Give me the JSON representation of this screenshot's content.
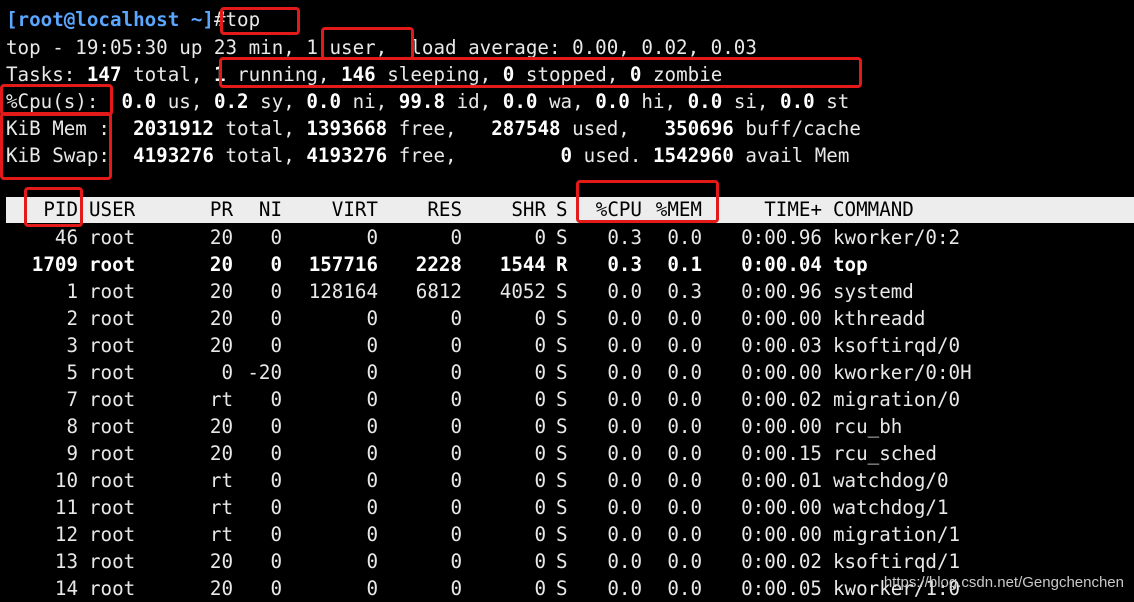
{
  "prompt": {
    "user_host": "[root@localhost ~]",
    "command": "#top"
  },
  "summary": {
    "line1": {
      "prefix": "top - 19:05:30 up 23 min, ",
      "users": "1 user,",
      "load": "  load average: 0.00, 0.02, 0.03"
    },
    "line2": {
      "label": "Tasks: ",
      "total": "147",
      "total_word": " total, ",
      "running": "1",
      "running_word": " running, ",
      "sleeping": "146",
      "sleeping_word": " sleeping, ",
      "stopped": "0",
      "stopped_word": " stopped, ",
      "zombie": "0",
      "zombie_word": " zombie"
    },
    "line3": {
      "label": "%Cpu(s):",
      "us": "0.0",
      "us_word": " us, ",
      "sy": "0.2",
      "sy_word": " sy, ",
      "ni": "0.0",
      "ni_word": " ni, ",
      "id": "99.8",
      "id_word": " id, ",
      "wa": "0.0",
      "wa_word": " wa, ",
      "hi": "0.0",
      "hi_word": " hi, ",
      "si": "0.0",
      "si_word": " si, ",
      "st": "0.0",
      "st_word": " st"
    },
    "line4": {
      "label": "KiB Mem :",
      "total": "2031912",
      "total_word": " total, ",
      "free": "1393668",
      "free_word": " free, ",
      "used": "287548",
      "used_word": " used, ",
      "cache": "350696",
      "cache_word": " buff/cache"
    },
    "line5": {
      "label": "KiB Swap:",
      "total": "4193276",
      "total_word": " total, ",
      "free": "4193276",
      "free_word": " free, ",
      "used": "0",
      "used_word": " used. ",
      "avail": "1542960",
      "avail_word": " avail Mem"
    }
  },
  "table": {
    "headers": [
      "PID",
      "USER",
      "PR",
      "NI",
      "VIRT",
      "RES",
      "SHR",
      "S",
      "%CPU",
      "%MEM",
      "TIME+",
      "COMMAND"
    ],
    "rows": [
      [
        "46",
        "root",
        "20",
        "0",
        "0",
        "0",
        "0",
        "S",
        "0.3",
        "0.0",
        "0:00.96",
        "kworker/0:2"
      ],
      [
        "1709",
        "root",
        "20",
        "0",
        "157716",
        "2228",
        "1544",
        "R",
        "0.3",
        "0.1",
        "0:00.04",
        "top"
      ],
      [
        "1",
        "root",
        "20",
        "0",
        "128164",
        "6812",
        "4052",
        "S",
        "0.0",
        "0.3",
        "0:00.96",
        "systemd"
      ],
      [
        "2",
        "root",
        "20",
        "0",
        "0",
        "0",
        "0",
        "S",
        "0.0",
        "0.0",
        "0:00.00",
        "kthreadd"
      ],
      [
        "3",
        "root",
        "20",
        "0",
        "0",
        "0",
        "0",
        "S",
        "0.0",
        "0.0",
        "0:00.03",
        "ksoftirqd/0"
      ],
      [
        "5",
        "root",
        "0",
        "-20",
        "0",
        "0",
        "0",
        "S",
        "0.0",
        "0.0",
        "0:00.00",
        "kworker/0:0H"
      ],
      [
        "7",
        "root",
        "rt",
        "0",
        "0",
        "0",
        "0",
        "S",
        "0.0",
        "0.0",
        "0:00.02",
        "migration/0"
      ],
      [
        "8",
        "root",
        "20",
        "0",
        "0",
        "0",
        "0",
        "S",
        "0.0",
        "0.0",
        "0:00.00",
        "rcu_bh"
      ],
      [
        "9",
        "root",
        "20",
        "0",
        "0",
        "0",
        "0",
        "S",
        "0.0",
        "0.0",
        "0:00.15",
        "rcu_sched"
      ],
      [
        "10",
        "root",
        "rt",
        "0",
        "0",
        "0",
        "0",
        "S",
        "0.0",
        "0.0",
        "0:00.01",
        "watchdog/0"
      ],
      [
        "11",
        "root",
        "rt",
        "0",
        "0",
        "0",
        "0",
        "S",
        "0.0",
        "0.0",
        "0:00.00",
        "watchdog/1"
      ],
      [
        "12",
        "root",
        "rt",
        "0",
        "0",
        "0",
        "0",
        "S",
        "0.0",
        "0.0",
        "0:00.00",
        "migration/1"
      ],
      [
        "13",
        "root",
        "20",
        "0",
        "0",
        "0",
        "0",
        "S",
        "0.0",
        "0.0",
        "0:00.02",
        "ksoftirqd/1"
      ],
      [
        "14",
        "root",
        "20",
        "0",
        "0",
        "0",
        "0",
        "S",
        "0.0",
        "0.0",
        "0:00.05",
        "kworker/1:0"
      ]
    ],
    "bold_row_index": 1
  },
  "watermark": "https://blog.csdn.net/Gengchenchen",
  "colors": {
    "background": "#000000",
    "text": "#e8e8e8",
    "prompt": "#5ba6ff",
    "header_bar": "#ededed",
    "highlight_box": "#e31a1a"
  }
}
